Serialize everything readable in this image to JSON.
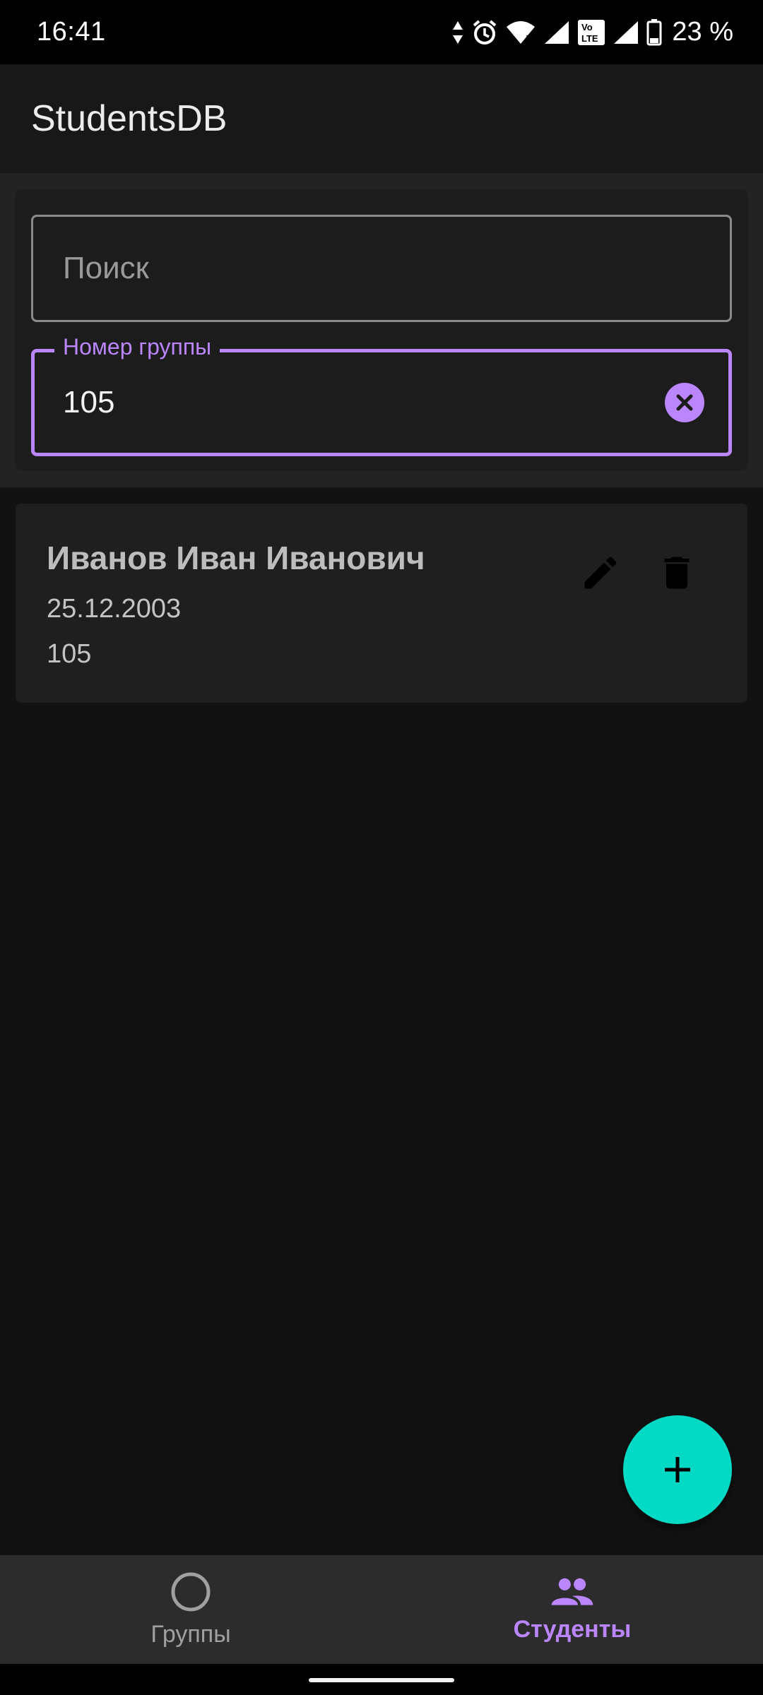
{
  "status_bar": {
    "time": "16:41",
    "battery_text": "23 %",
    "icons": [
      "data-arrows-icon",
      "alarm-icon",
      "wifi-icon",
      "signal-icon",
      "volte-icon",
      "signal-icon",
      "battery-icon"
    ]
  },
  "app_bar": {
    "title": "StudentsDB"
  },
  "filters": {
    "search": {
      "placeholder": "Поиск",
      "value": ""
    },
    "group": {
      "label": "Номер группы",
      "value": "105"
    }
  },
  "students": [
    {
      "name": "Иванов Иван Иванович",
      "birth_date": "25.12.2003",
      "group": "105"
    }
  ],
  "fab": {
    "icon": "plus-icon"
  },
  "bottom_nav": {
    "items": [
      {
        "label": "Группы",
        "icon": "circle-icon",
        "active": false
      },
      {
        "label": "Студенты",
        "icon": "people-icon",
        "active": true
      }
    ]
  },
  "colors": {
    "accent": "#bb86fc",
    "fab": "#03dac5",
    "background": "#121212"
  }
}
